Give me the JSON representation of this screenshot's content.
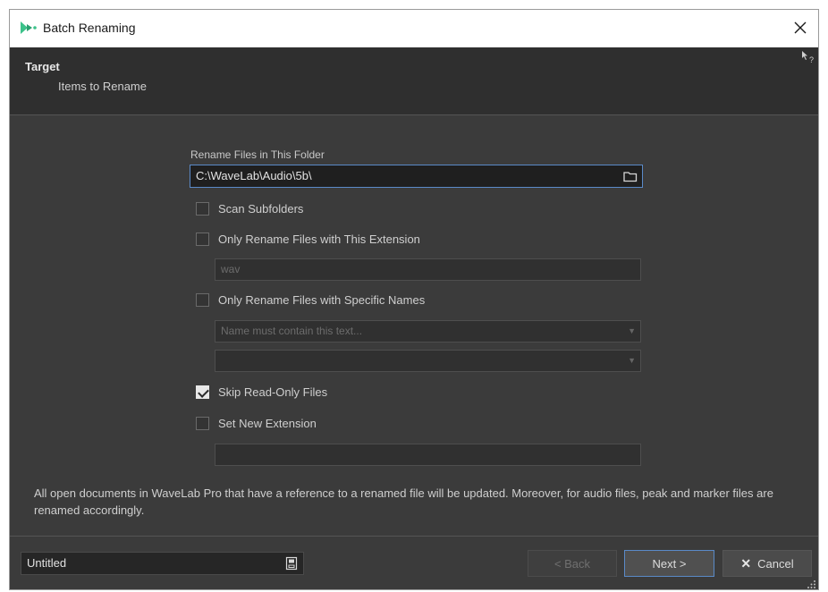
{
  "window": {
    "title": "Batch Renaming"
  },
  "header": {
    "title": "Target",
    "subtitle": "Items to Rename"
  },
  "form": {
    "folder_label": "Rename Files in This Folder",
    "folder_path": "C:\\WaveLab\\Audio\\5b\\",
    "scan_subfolders": {
      "label": "Scan Subfolders",
      "checked": false
    },
    "only_extension": {
      "label": "Only Rename Files with This Extension",
      "checked": false,
      "value": "wav"
    },
    "only_specific_names": {
      "label": "Only Rename Files with Specific Names",
      "checked": false,
      "name_filter_placeholder": "Name must contain this text...",
      "second_filter_value": ""
    },
    "skip_readonly": {
      "label": "Skip Read-Only Files",
      "checked": true
    },
    "set_new_extension": {
      "label": "Set New Extension",
      "checked": false,
      "value": ""
    }
  },
  "info": "All open documents in WaveLab Pro that have a reference to a renamed file will be updated. Moreover, for audio files, peak and marker files are renamed accordingly.",
  "footer": {
    "preset_name": "Untitled",
    "back_label": "< Back",
    "next_label": "Next >",
    "cancel_label": "Cancel"
  },
  "icons": {
    "app": "wavelab-app-icon",
    "close": "close-icon",
    "help": "help-pointer-icon",
    "folder": "folder-icon",
    "preset": "preset-save-icon",
    "cancel": "x-icon"
  },
  "colors": {
    "background": "#3b3b3b",
    "header": "#2f2f2f",
    "accent": "#5a8ac8",
    "app_icon_green": "#3cc28a"
  }
}
